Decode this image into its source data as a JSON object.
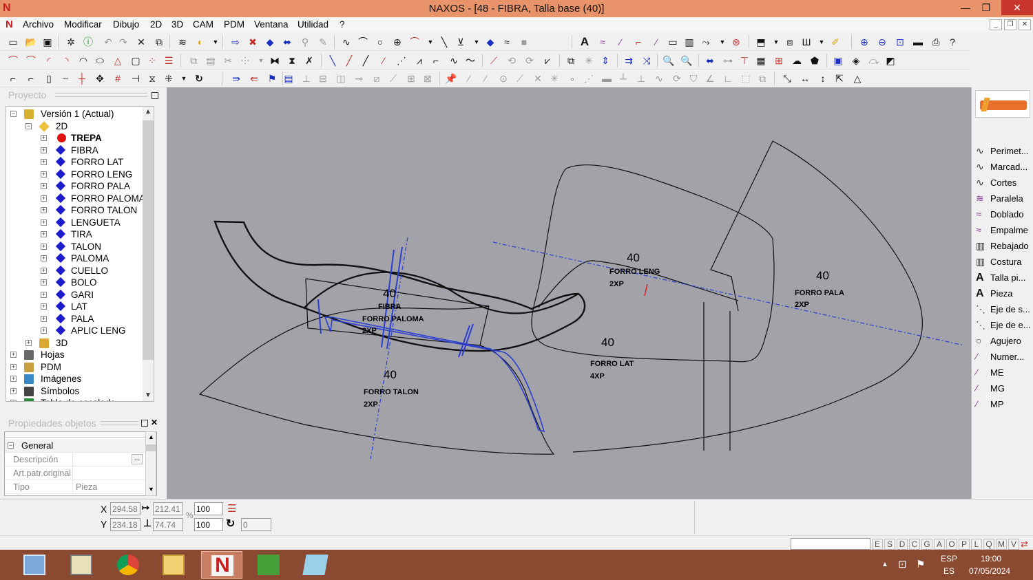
{
  "window": {
    "title": "NAXOS - [48 - FIBRA, Talla base (40)]",
    "min": "—",
    "restore": "❐",
    "close": "✕"
  },
  "menu": {
    "items": [
      "Archivo",
      "Modificar",
      "Dibujo",
      "2D",
      "3D",
      "CAM",
      "PDM",
      "Ventana",
      "Utilidad",
      "?"
    ]
  },
  "project_panel": {
    "title": "Proyecto",
    "tree": [
      {
        "label": "Versión 1 (Actual)",
        "level": 0,
        "icon": "version-icon",
        "expanded": true
      },
      {
        "label": "2D",
        "level": 1,
        "icon": "2d-folder-icon",
        "expanded": true
      },
      {
        "label": "TREPA",
        "level": 2,
        "icon": "red-dot-icon",
        "bold": true
      },
      {
        "label": "FIBRA",
        "level": 2,
        "icon": "blue-diamond-icon"
      },
      {
        "label": "FORRO LAT",
        "level": 2,
        "icon": "blue-diamond-icon"
      },
      {
        "label": "FORRO LENG",
        "level": 2,
        "icon": "blue-diamond-icon"
      },
      {
        "label": "FORRO PALA",
        "level": 2,
        "icon": "blue-diamond-icon"
      },
      {
        "label": "FORRO PALOMA",
        "level": 2,
        "icon": "blue-diamond-icon"
      },
      {
        "label": "FORRO TALON",
        "level": 2,
        "icon": "blue-diamond-icon"
      },
      {
        "label": "LENGUETA",
        "level": 2,
        "icon": "blue-diamond-icon"
      },
      {
        "label": "TIRA",
        "level": 2,
        "icon": "blue-diamond-icon"
      },
      {
        "label": "TALON",
        "level": 2,
        "icon": "blue-diamond-icon"
      },
      {
        "label": "PALOMA",
        "level": 2,
        "icon": "blue-diamond-icon"
      },
      {
        "label": "CUELLO",
        "level": 2,
        "icon": "blue-diamond-icon"
      },
      {
        "label": "BOLO",
        "level": 2,
        "icon": "blue-diamond-icon"
      },
      {
        "label": "GARI",
        "level": 2,
        "icon": "blue-diamond-icon"
      },
      {
        "label": "LAT",
        "level": 2,
        "icon": "blue-diamond-icon"
      },
      {
        "label": "PALA",
        "level": 2,
        "icon": "blue-diamond-icon"
      },
      {
        "label": "APLIC LENG",
        "level": 2,
        "icon": "blue-diamond-icon"
      },
      {
        "label": "3D",
        "level": 1,
        "icon": "3d-icon"
      },
      {
        "label": "Hojas",
        "level": 0,
        "icon": "sheets-icon"
      },
      {
        "label": "PDM",
        "level": 0,
        "icon": "pdm-folder-icon"
      },
      {
        "label": "Imágenes",
        "level": 0,
        "icon": "images-icon"
      },
      {
        "label": "Símbolos",
        "level": 0,
        "icon": "symbols-icon"
      },
      {
        "label": "Tabla de escalado",
        "level": 0,
        "icon": "table-icon"
      }
    ]
  },
  "properties_panel": {
    "title": "Propiedades objetos",
    "section": "General",
    "rows": [
      {
        "label": "Descripción",
        "value": "",
        "button": "..."
      },
      {
        "label": "Art.patr.original",
        "value": ""
      },
      {
        "label": "Tipo",
        "value": "Pieza"
      }
    ]
  },
  "canvas_labels": [
    {
      "size": "40",
      "name": "FORRO LENG",
      "qty": "2XP"
    },
    {
      "size": "40",
      "name": "FORRO PALA",
      "qty": "2XP"
    },
    {
      "size": "40",
      "name": "FIBRA",
      "qty": ""
    },
    {
      "size": "",
      "name": "FORRO PALOMA",
      "qty": "2XP"
    },
    {
      "size": "40",
      "name": "FORRO LAT",
      "qty": "4XP"
    },
    {
      "size": "40",
      "name": "FORRO TALON",
      "qty": "2XP"
    }
  ],
  "right_tools": [
    {
      "label": "Perimet...",
      "icon": "curve-icon"
    },
    {
      "label": "Marcad...",
      "icon": "curve-icon"
    },
    {
      "label": "Cortes",
      "icon": "curve-icon"
    },
    {
      "label": "Paralela",
      "icon": "parallel-curve-icon"
    },
    {
      "label": "Doblado",
      "icon": "fold-curve-icon"
    },
    {
      "label": "Empalme",
      "icon": "join-curve-icon"
    },
    {
      "label": "Rebajado",
      "icon": "skive-icon"
    },
    {
      "label": "Costura",
      "icon": "seam-icon"
    },
    {
      "label": "Talla pi...",
      "icon": "text-a-icon"
    },
    {
      "label": "Pieza",
      "icon": "text-a-icon"
    },
    {
      "label": "Eje de s...",
      "icon": "axis-icon"
    },
    {
      "label": "Eje de e...",
      "icon": "axis-icon"
    },
    {
      "label": "Agujero",
      "icon": "hole-icon"
    },
    {
      "label": "Numer...",
      "icon": "pen-icon"
    },
    {
      "label": "ME",
      "icon": "pen-icon"
    },
    {
      "label": "MG",
      "icon": "pen-icon"
    },
    {
      "label": "MP",
      "icon": "pen-icon"
    }
  ],
  "status": {
    "x_label": "X",
    "x": "294.58",
    "y_label": "Y",
    "y": "234.18",
    "width": "212.41",
    "height": "74.74",
    "scale_x": "100",
    "scale_y": "100",
    "percent": "%",
    "rotation": "0",
    "flags": [
      "E",
      "S",
      "D",
      "C",
      "G",
      "A",
      "O",
      "P",
      "L",
      "Q",
      "M",
      "V"
    ]
  },
  "taskbar": {
    "lang_top": "ESP",
    "lang_bottom": "ES",
    "time": "19:00",
    "date": "07/05/2024",
    "apps": [
      "calculator-icon",
      "file-explorer-icon",
      "chrome-icon",
      "folder-icon",
      "naxos-icon",
      "leaf-app-icon",
      "notes-icon"
    ]
  },
  "colors": {
    "title_bar": "#e8936a",
    "canvas": "#a2a2a8",
    "taskbar": "#8a4a32",
    "accent_blue": "#1c1ccc",
    "accent_red": "#e01010"
  }
}
